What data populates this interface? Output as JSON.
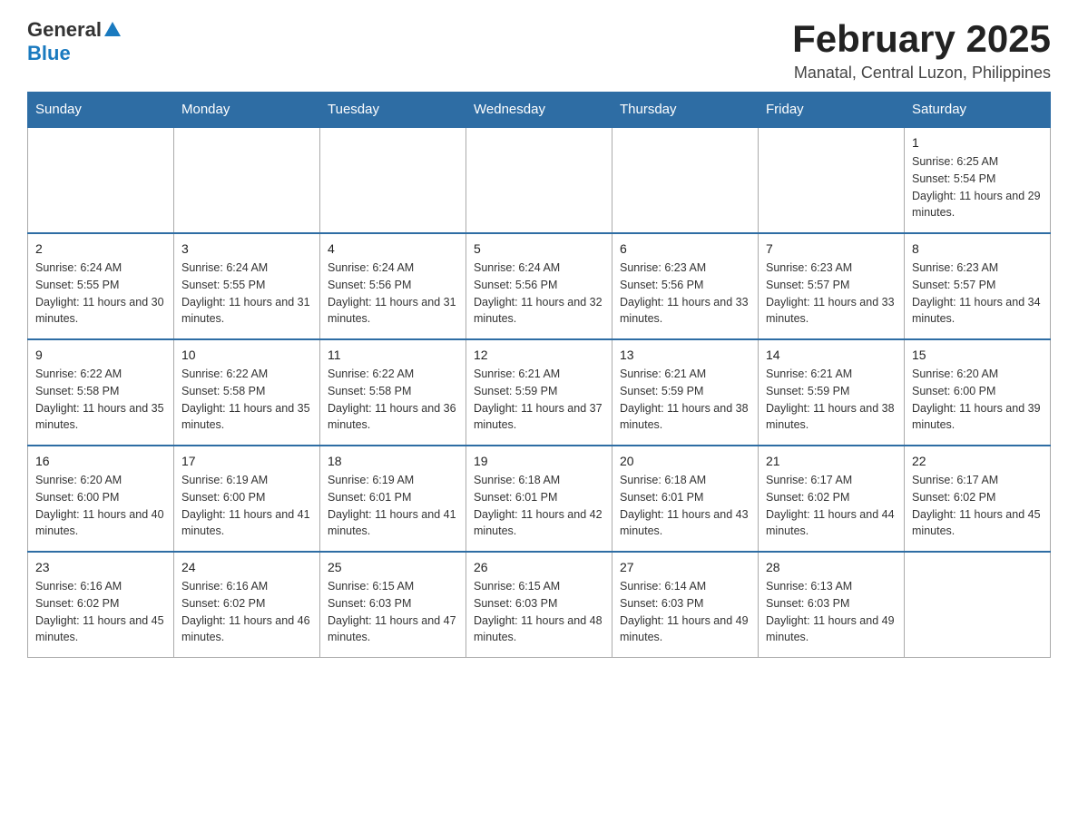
{
  "header": {
    "logo_general": "General",
    "logo_blue": "Blue",
    "month_year": "February 2025",
    "location": "Manatal, Central Luzon, Philippines"
  },
  "days_of_week": [
    "Sunday",
    "Monday",
    "Tuesday",
    "Wednesday",
    "Thursday",
    "Friday",
    "Saturday"
  ],
  "weeks": [
    {
      "days": [
        {
          "number": "",
          "info": ""
        },
        {
          "number": "",
          "info": ""
        },
        {
          "number": "",
          "info": ""
        },
        {
          "number": "",
          "info": ""
        },
        {
          "number": "",
          "info": ""
        },
        {
          "number": "",
          "info": ""
        },
        {
          "number": "1",
          "info": "Sunrise: 6:25 AM\nSunset: 5:54 PM\nDaylight: 11 hours and 29 minutes."
        }
      ]
    },
    {
      "days": [
        {
          "number": "2",
          "info": "Sunrise: 6:24 AM\nSunset: 5:55 PM\nDaylight: 11 hours and 30 minutes."
        },
        {
          "number": "3",
          "info": "Sunrise: 6:24 AM\nSunset: 5:55 PM\nDaylight: 11 hours and 31 minutes."
        },
        {
          "number": "4",
          "info": "Sunrise: 6:24 AM\nSunset: 5:56 PM\nDaylight: 11 hours and 31 minutes."
        },
        {
          "number": "5",
          "info": "Sunrise: 6:24 AM\nSunset: 5:56 PM\nDaylight: 11 hours and 32 minutes."
        },
        {
          "number": "6",
          "info": "Sunrise: 6:23 AM\nSunset: 5:56 PM\nDaylight: 11 hours and 33 minutes."
        },
        {
          "number": "7",
          "info": "Sunrise: 6:23 AM\nSunset: 5:57 PM\nDaylight: 11 hours and 33 minutes."
        },
        {
          "number": "8",
          "info": "Sunrise: 6:23 AM\nSunset: 5:57 PM\nDaylight: 11 hours and 34 minutes."
        }
      ]
    },
    {
      "days": [
        {
          "number": "9",
          "info": "Sunrise: 6:22 AM\nSunset: 5:58 PM\nDaylight: 11 hours and 35 minutes."
        },
        {
          "number": "10",
          "info": "Sunrise: 6:22 AM\nSunset: 5:58 PM\nDaylight: 11 hours and 35 minutes."
        },
        {
          "number": "11",
          "info": "Sunrise: 6:22 AM\nSunset: 5:58 PM\nDaylight: 11 hours and 36 minutes."
        },
        {
          "number": "12",
          "info": "Sunrise: 6:21 AM\nSunset: 5:59 PM\nDaylight: 11 hours and 37 minutes."
        },
        {
          "number": "13",
          "info": "Sunrise: 6:21 AM\nSunset: 5:59 PM\nDaylight: 11 hours and 38 minutes."
        },
        {
          "number": "14",
          "info": "Sunrise: 6:21 AM\nSunset: 5:59 PM\nDaylight: 11 hours and 38 minutes."
        },
        {
          "number": "15",
          "info": "Sunrise: 6:20 AM\nSunset: 6:00 PM\nDaylight: 11 hours and 39 minutes."
        }
      ]
    },
    {
      "days": [
        {
          "number": "16",
          "info": "Sunrise: 6:20 AM\nSunset: 6:00 PM\nDaylight: 11 hours and 40 minutes."
        },
        {
          "number": "17",
          "info": "Sunrise: 6:19 AM\nSunset: 6:00 PM\nDaylight: 11 hours and 41 minutes."
        },
        {
          "number": "18",
          "info": "Sunrise: 6:19 AM\nSunset: 6:01 PM\nDaylight: 11 hours and 41 minutes."
        },
        {
          "number": "19",
          "info": "Sunrise: 6:18 AM\nSunset: 6:01 PM\nDaylight: 11 hours and 42 minutes."
        },
        {
          "number": "20",
          "info": "Sunrise: 6:18 AM\nSunset: 6:01 PM\nDaylight: 11 hours and 43 minutes."
        },
        {
          "number": "21",
          "info": "Sunrise: 6:17 AM\nSunset: 6:02 PM\nDaylight: 11 hours and 44 minutes."
        },
        {
          "number": "22",
          "info": "Sunrise: 6:17 AM\nSunset: 6:02 PM\nDaylight: 11 hours and 45 minutes."
        }
      ]
    },
    {
      "days": [
        {
          "number": "23",
          "info": "Sunrise: 6:16 AM\nSunset: 6:02 PM\nDaylight: 11 hours and 45 minutes."
        },
        {
          "number": "24",
          "info": "Sunrise: 6:16 AM\nSunset: 6:02 PM\nDaylight: 11 hours and 46 minutes."
        },
        {
          "number": "25",
          "info": "Sunrise: 6:15 AM\nSunset: 6:03 PM\nDaylight: 11 hours and 47 minutes."
        },
        {
          "number": "26",
          "info": "Sunrise: 6:15 AM\nSunset: 6:03 PM\nDaylight: 11 hours and 48 minutes."
        },
        {
          "number": "27",
          "info": "Sunrise: 6:14 AM\nSunset: 6:03 PM\nDaylight: 11 hours and 49 minutes."
        },
        {
          "number": "28",
          "info": "Sunrise: 6:13 AM\nSunset: 6:03 PM\nDaylight: 11 hours and 49 minutes."
        },
        {
          "number": "",
          "info": ""
        }
      ]
    }
  ]
}
